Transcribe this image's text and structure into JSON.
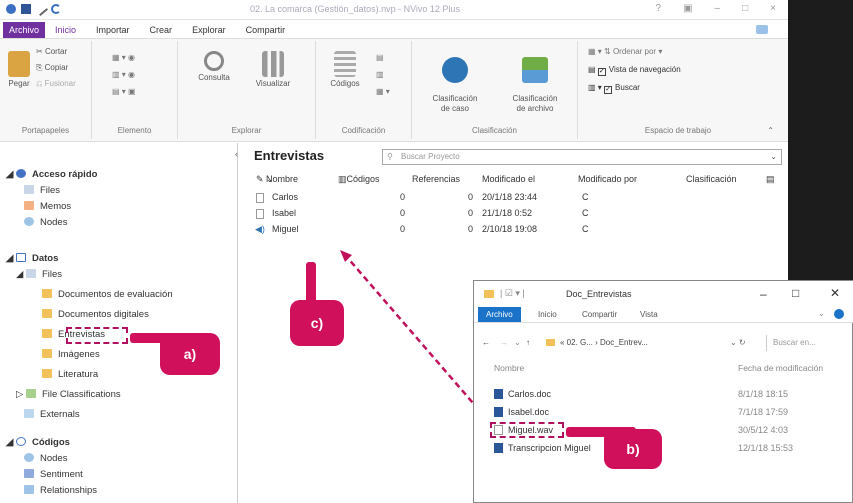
{
  "window": {
    "title": "02. La comarca (Gestión_datos).nvp - NVivo 12 Plus",
    "controls": [
      "?",
      "▣",
      "–",
      "□",
      "×"
    ]
  },
  "menu_tabs": [
    "Archivo",
    "Inicio",
    "Importar",
    "Crear",
    "Explorar",
    "Compartir"
  ],
  "ribbon": {
    "portapapeles": {
      "paste": "Pegar",
      "cut": "Cortar",
      "copy": "Copiar",
      "merge": "Fusionar",
      "label": "Portapapeles"
    },
    "elemento": {
      "label": "Elemento"
    },
    "explorar": {
      "query": "Consulta",
      "visualize": "Visualizar",
      "label": "Explorar"
    },
    "codificacion": {
      "codes": "Códigos",
      "label": "Codificación"
    },
    "clasificacion": {
      "case": "Clasificación\nde caso",
      "file": "Clasificación\nde archivo",
      "label": "Clasificación"
    },
    "espacio": {
      "sort": "Ordenar por",
      "nav_view": "Vista de navegación",
      "search": "Buscar",
      "label": "Espacio de trabajo"
    }
  },
  "nav": {
    "quick_access": "Acceso rápido",
    "quick_items": [
      "Files",
      "Memos",
      "Nodes"
    ],
    "data": "Datos",
    "files": "Files",
    "file_folders": [
      "Documentos de evaluación",
      "Documentos digitales",
      "Entrevistas",
      "Imágenes",
      "Literatura"
    ],
    "file_classifications": "File Classifications",
    "externals": "Externals",
    "codes": "Códigos",
    "code_items": [
      "Nodes",
      "Sentiment",
      "Relationships"
    ]
  },
  "detail": {
    "title": "Entrevistas",
    "search_placeholder": "Buscar Proyecto",
    "columns": [
      "Nombre",
      "Códigos",
      "Referencias",
      "Modificado el",
      "Modificado por",
      "Clasificación"
    ],
    "rows": [
      {
        "name": "Carlos",
        "codes": "0",
        "refs": "0",
        "modified": "20/1/18 23:44",
        "by": "C"
      },
      {
        "name": "Isabel",
        "codes": "0",
        "refs": "0",
        "modified": "21/1/18 0:52",
        "by": "C"
      },
      {
        "name": "Miguel",
        "codes": "0",
        "refs": "0",
        "modified": "2/10/18 19:08",
        "by": "C"
      }
    ]
  },
  "explorer": {
    "title": "Doc_Entrevistas",
    "tabs": [
      "Archivo",
      "Inicio",
      "Compartir",
      "Vista"
    ],
    "path": "« 02. G... › Doc_Entrev...",
    "search_placeholder": "Buscar en...",
    "columns": [
      "Nombre",
      "Fecha de modificación"
    ],
    "files": [
      {
        "name": "Carlos.doc",
        "date": "8/1/18 18:15"
      },
      {
        "name": "Isabel.doc",
        "date": "7/1/18 17:59"
      },
      {
        "name": "Miguel.wav",
        "date": "30/5/12 4:03"
      },
      {
        "name": "Transcripcion Miguel",
        "date": "12/1/18 15:53"
      }
    ]
  },
  "callouts": {
    "a": "a)",
    "b": "b)",
    "c": "c)"
  },
  "colors": {
    "accent": "#7030a0",
    "callout": "#d0105a"
  }
}
